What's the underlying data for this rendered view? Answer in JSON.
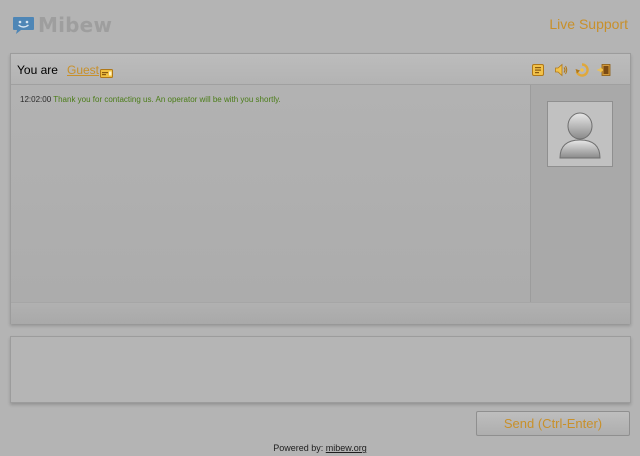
{
  "header": {
    "logo_text": "Mibew",
    "logo_icon": "chat-bubble-smile-icon",
    "live_support": "Live Support"
  },
  "chat": {
    "you_are_label": "You are",
    "user_name": "Guest",
    "header_icons": [
      "history-icon",
      "sound-icon",
      "refresh-icon",
      "close-icon"
    ],
    "messages": [
      {
        "time": "12:02:00",
        "text": "Thank you for contacting us. An operator will be with you shortly."
      }
    ],
    "operator_avatar": "default-avatar-icon"
  },
  "input": {
    "value": "",
    "placeholder": ""
  },
  "send_label": "Send (Ctrl-Enter)",
  "footer": {
    "powered_by": "Powered by:",
    "link_text": "mibew.org"
  },
  "colors": {
    "background": "#b4b4b4",
    "accent": "#c8902a",
    "message_text": "#4b7d18",
    "logo": "#9e9e9e"
  }
}
